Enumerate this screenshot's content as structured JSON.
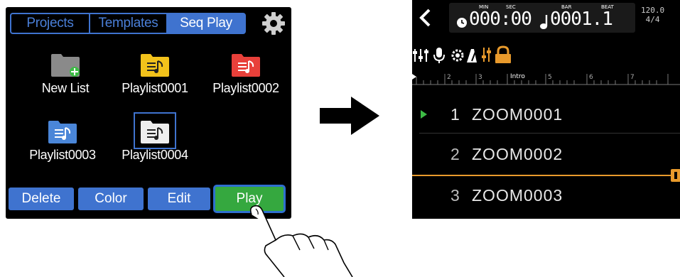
{
  "left_screen": {
    "tabs": [
      {
        "label": "Projects",
        "active": false
      },
      {
        "label": "Templates",
        "active": false
      },
      {
        "label": "Seq Play",
        "active": true
      }
    ],
    "settings_icon": "gear-icon",
    "items": [
      {
        "label": "New List",
        "folder_color": "#8a8a8a",
        "icon": "new-list-folder-icon"
      },
      {
        "label": "Playlist0001",
        "folder_color": "#f2c21b",
        "icon": "playlist-folder-icon"
      },
      {
        "label": "Playlist0002",
        "folder_color": "#e8403a",
        "icon": "playlist-folder-icon"
      },
      {
        "label": "Playlist0003",
        "folder_color": "#4a86d8",
        "icon": "playlist-folder-icon"
      },
      {
        "label": "Playlist0004",
        "folder_color": "#eeeeee",
        "icon": "playlist-folder-icon",
        "selected": true
      }
    ],
    "buttons": [
      {
        "label": "Delete"
      },
      {
        "label": "Color"
      },
      {
        "label": "Edit"
      },
      {
        "label": "Play",
        "highlighted": true
      }
    ]
  },
  "right_screen": {
    "time_counter": {
      "min_label": "MIN",
      "sec_label": "SEC",
      "value": "000:00"
    },
    "bar_counter": {
      "bar_label": "BAR",
      "beat_label": "BEAT",
      "value": "0001.1"
    },
    "tempo": "120.0",
    "time_signature": "4/4",
    "ruler": {
      "marks": [
        "2",
        "3",
        "Intro",
        "5",
        "6",
        "7"
      ]
    },
    "tracks": [
      {
        "number": "1",
        "name": "ZOOM0001",
        "playing": true
      },
      {
        "number": "2",
        "name": "ZOOM0002",
        "playing": false
      },
      {
        "number": "3",
        "name": "ZOOM0003",
        "playing": false
      }
    ],
    "colors": {
      "accent_orange": "#e89a2c",
      "play_green": "#3dbb45",
      "ui_blue": "#3f73cf"
    }
  }
}
